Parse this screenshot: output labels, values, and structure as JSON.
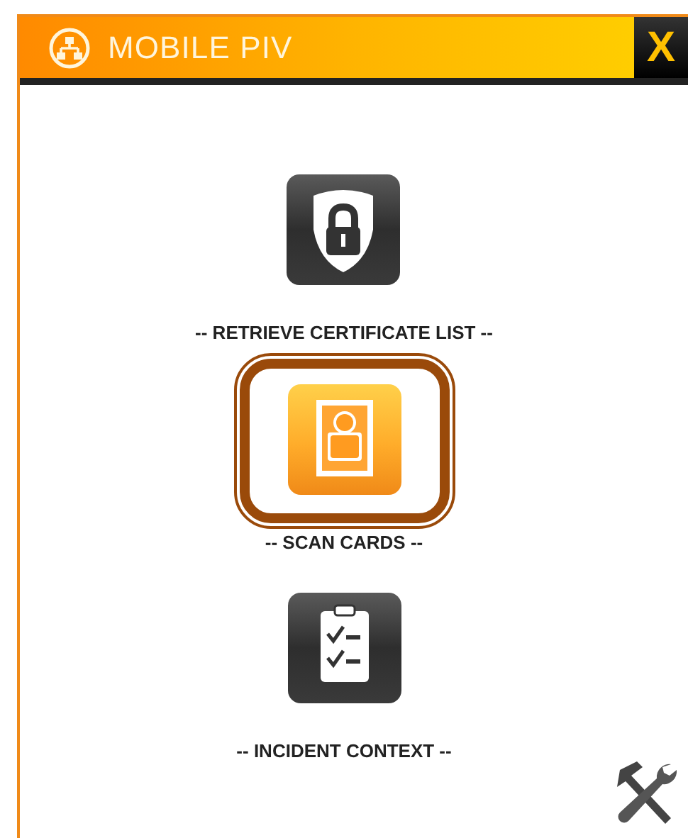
{
  "window": {
    "title": "MOBILE PIV",
    "close": "X"
  },
  "menu": [
    {
      "kind": "lock",
      "label": "-- RETRIEVE CERTIFICATE LIST --",
      "selected": false
    },
    {
      "kind": "person",
      "label": "-- SCAN CARDS --",
      "selected": true
    },
    {
      "kind": "clipboard",
      "label": "-- INCIDENT CONTEXT --",
      "selected": false
    }
  ]
}
